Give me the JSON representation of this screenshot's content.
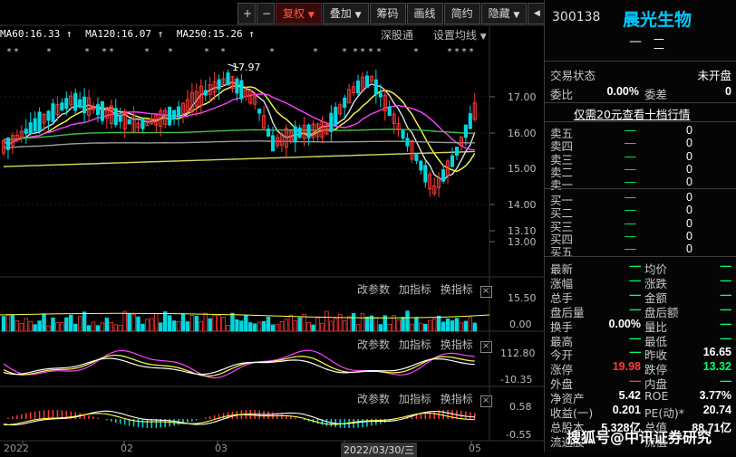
{
  "toolbar": {
    "plus": "+",
    "minus": "−",
    "fuquan": "复权",
    "diejia": "叠加",
    "chouma": "筹码",
    "huaxian": "画线",
    "jianyue": "简约",
    "yincang": "隐藏",
    "nav_left": "◀",
    "nav_right": "▶"
  },
  "ma_legend": [
    {
      "text": "MA60:16.33 ↑",
      "color": "#ffffff"
    },
    {
      "text": "MA120:16.07 ↑",
      "color": "#00e0e0"
    },
    {
      "text": "MA250:15.26 ↑",
      "color": "#ffff44"
    }
  ],
  "chart_header": {
    "exchange": "深股通",
    "cycle": "设置均线"
  },
  "price_axis": [
    "17.00",
    "16.00",
    "15.00",
    "14.00",
    "13.10",
    "13.00"
  ],
  "high_label": "17.97",
  "vol_axis": [
    "15.50",
    "0.00"
  ],
  "macd_axis": [
    "112.80",
    "-10.35"
  ],
  "kdj_axis": [
    "0.58",
    "-0.55"
  ],
  "sub_controls": {
    "change_param": "改参数",
    "add_indicator": "加指标",
    "switch_indicator": "换指标",
    "close": "×"
  },
  "date_axis": [
    "2022",
    "02",
    "03",
    "2022/03/30/三",
    "05"
  ],
  "stock": {
    "code": "300138",
    "name": "晨光生物",
    "price_dash": "—",
    "change_dash": "—"
  },
  "panel": {
    "trade_status_label": "交易状态",
    "trade_status_value": "未开盘",
    "weibi_label": "委比",
    "weibi_value": "0.00%",
    "weicha_label": "委差",
    "weicha_value": "0",
    "promo": "仅需20元查看十档行情",
    "asks": [
      {
        "label": "卖五",
        "price": "—",
        "vol": "0"
      },
      {
        "label": "卖四",
        "price": "—",
        "vol": "0"
      },
      {
        "label": "卖三",
        "price": "—",
        "vol": "0"
      },
      {
        "label": "卖二",
        "price": "—",
        "vol": "0"
      },
      {
        "label": "卖一",
        "price": "—",
        "vol": "0"
      }
    ],
    "bids": [
      {
        "label": "买一",
        "price": "—",
        "vol": "0"
      },
      {
        "label": "买二",
        "price": "—",
        "vol": "0"
      },
      {
        "label": "买三",
        "price": "—",
        "vol": "0"
      },
      {
        "label": "买四",
        "price": "—",
        "vol": "0"
      },
      {
        "label": "买五",
        "price": "—",
        "vol": "0"
      }
    ],
    "stats": [
      {
        "l1": "最新",
        "v1": "—",
        "c1": "#00ff66",
        "l2": "均价",
        "v2": "—",
        "c2": "#00ff66"
      },
      {
        "l1": "涨幅",
        "v1": "—",
        "c1": "#00ff66",
        "l2": "涨跌",
        "v2": "—",
        "c2": "#00ff66"
      },
      {
        "l1": "总手",
        "v1": "—",
        "c1": "#00ff66",
        "l2": "金额",
        "v2": "—",
        "c2": "#00ff66"
      },
      {
        "l1": "盘后量",
        "v1": "—",
        "c1": "#00ff66",
        "l2": "盘后额",
        "v2": "—",
        "c2": "#00ff66"
      },
      {
        "l1": "换手",
        "v1": "0.00%",
        "c1": "#ffffff",
        "l2": "量比",
        "v2": "—",
        "c2": "#00ff66"
      },
      {
        "l1": "最高",
        "v1": "—",
        "c1": "#00ff66",
        "l2": "最低",
        "v2": "—",
        "c2": "#00ff66"
      },
      {
        "l1": "今开",
        "v1": "—",
        "c1": "#00ff66",
        "l2": "昨收",
        "v2": "16.65",
        "c2": "#ffffff"
      },
      {
        "l1": "涨停",
        "v1": "19.98",
        "c1": "#ff3b3b",
        "l2": "跌停",
        "v2": "13.32",
        "c2": "#00ff66"
      },
      {
        "l1": "外盘",
        "v1": "—",
        "c1": "#ff3b3b",
        "l2": "内盘",
        "v2": "—",
        "c2": "#00ff66"
      },
      {
        "l1": "净资产",
        "v1": "5.42",
        "c1": "#ffffff",
        "l2": "ROE",
        "v2": "3.77%",
        "c2": "#ffffff"
      },
      {
        "l1": "收益(一)",
        "v1": "0.201",
        "c1": "#ffffff",
        "l2": "PE(动)*",
        "v2": "20.74",
        "c2": "#ffffff"
      },
      {
        "l1": "总股本",
        "v1": "5.328亿",
        "c1": "#ffffff",
        "l2": "总值",
        "v2": "88.71亿",
        "c2": "#ffffff"
      },
      {
        "l1": "流通股",
        "v1": "",
        "c1": "#ffffff",
        "l2": "流值",
        "v2": "",
        "c2": "#ffffff"
      }
    ]
  },
  "watermark": "搜狐号@中讯证券研究",
  "colors": {
    "up": "#ff3b3b",
    "down": "#00d8e0",
    "ma_white": "#e0e0e0",
    "ma_yellow": "#ffff44",
    "ma_magenta": "#ff40ff",
    "ma_green": "#40c040",
    "ma_cyan": "#40d0d0"
  }
}
